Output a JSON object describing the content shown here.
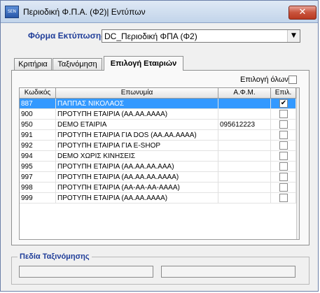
{
  "window": {
    "title": "Περιοδική Φ.Π.Α. (Φ2)| Εντύπων",
    "app_icon": "app-icon",
    "close_label": "✕"
  },
  "form": {
    "label": "Φόρμα Εκτύπωσης",
    "value": "DC_Περιοδική ΦΠΑ (Φ2)",
    "arrow": "▼"
  },
  "tabs": [
    {
      "label": "Κριτήρια",
      "active": false
    },
    {
      "label": "Ταξινόμηση",
      "active": false
    },
    {
      "label": "Επιλογή Εταιριών",
      "active": true
    }
  ],
  "select_all": {
    "label": "Επιλογή όλων",
    "checked": false
  },
  "grid": {
    "columns": [
      "Κωδικός",
      "Επωνυμία",
      "Α.Φ.Μ.",
      "Επιλ."
    ],
    "rows": [
      {
        "code": "887",
        "name": "ΠΑΠΠΑΣ ΝΙΚΟΛΑΟΣ",
        "afm": "",
        "checked": true,
        "selected": true
      },
      {
        "code": "900",
        "name": "ΠΡΟΤΥΠΗ  ΕΤΑΙΡΙΑ (ΑΑ.ΑΑ.ΑΑΑΑ)",
        "afm": "",
        "checked": false,
        "selected": false
      },
      {
        "code": "950",
        "name": "DEMO ΕΤΑΙΡΙΑ",
        "afm": "095612223",
        "checked": false,
        "selected": false
      },
      {
        "code": "991",
        "name": "ΠΡΟΤΥΠΗ ΕΤΑΙΡΙΑ ΓΙΑ DOS (ΑΑ.ΑΑ.ΑΑΑΑ)",
        "afm": "",
        "checked": false,
        "selected": false
      },
      {
        "code": "992",
        "name": "ΠΡΟΤΥΠΗ ΕΤΑΙΡΙΑ ΓΙΑ E-SHOP",
        "afm": "",
        "checked": false,
        "selected": false
      },
      {
        "code": "994",
        "name": "DEMO ΧΩΡΙΣ ΚΙΝΗΣΕΙΣ",
        "afm": "",
        "checked": false,
        "selected": false
      },
      {
        "code": "995",
        "name": "ΠΡΟΤΥΠΗ ΕΤΑΙΡΙΑ (ΑΑ.ΑΑ.ΑΑ.ΑΑΑ)",
        "afm": "",
        "checked": false,
        "selected": false
      },
      {
        "code": "997",
        "name": "ΠΡΟΤΥΠΗ ΕΤΑΙΡΙΑ (ΑΑ.ΑΑ.ΑΑ.ΑΑΑΑ)",
        "afm": "",
        "checked": false,
        "selected": false
      },
      {
        "code": "998",
        "name": "ΠΡΟΤΥΠΗ ΕΤΑΙΡΙΑ (ΑΑ-ΑΑ-ΑΑ-ΑΑΑΑ)",
        "afm": "",
        "checked": false,
        "selected": false
      },
      {
        "code": "999",
        "name": "ΠΡΟΤΥΠΗ ΕΤΑΙΡΙΑ (ΑΑ.ΑΑ.ΑΑΑΑ)",
        "afm": "",
        "checked": false,
        "selected": false
      }
    ]
  },
  "sort_fields": {
    "title": "Πεδία Ταξινόμησης",
    "fields": [
      "",
      ""
    ]
  },
  "colors": {
    "accent": "#1f3d99",
    "selection": "#3399ff",
    "close": "#c8533c"
  }
}
